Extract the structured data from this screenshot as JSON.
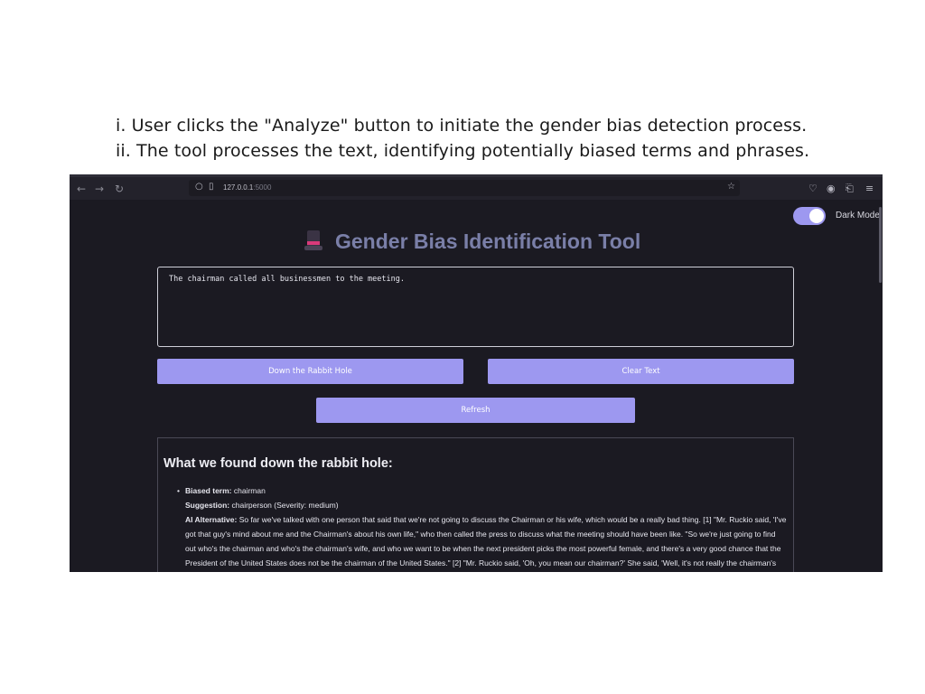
{
  "caption": {
    "line1": "i. User clicks the \"Analyze\" button to initiate the gender bias detection process.",
    "line2": "ii. The tool processes the text, identifying potentially biased terms and phrases."
  },
  "browser": {
    "url_host": "127.0.0.1",
    "url_port": ":5000"
  },
  "app": {
    "dark_mode_label": "Dark Mode",
    "dark_mode_on": true,
    "title": "Gender Bias Identification Tool",
    "input_text": "The chairman called all businessmen to the meeting.",
    "buttons": {
      "rabbit": "Down the Rabbit Hole",
      "clear": "Clear Text",
      "refresh": "Refresh"
    },
    "results": {
      "heading": "What we found down the rabbit hole:",
      "items": [
        {
          "biased_label": "Biased term:",
          "biased_value": "chairman",
          "suggestion_label": "Suggestion:",
          "suggestion_value": "chairperson (Severity: medium)",
          "alternative_label": "AI Alternative:",
          "alternative_value": "So far we've talked with one person that said that we're not going to discuss the Chairman or his wife, which would be a really bad thing. [1] \"Mr. Ruckio said, 'I've got that guy's mind about me and the Chairman's about his own life,\" who then called the press to discuss what the meeting should have been like. \"So we're just going to find out who's the chairman and who's the chairman's wife, and who we want to be when the next president picks the most powerful female, and there's a very good chance that the President of the United States does not be the chairman of the United States.\" [2] \"Mr. Ruckio said, 'Oh, you mean our chairman?' She said, 'Well, it's not really the chairman's"
        }
      ]
    }
  },
  "colors": {
    "app_bg": "#1b1a22",
    "accent": "#9d98f0",
    "title": "#7a7fa8",
    "hat_band": "#d93a7a"
  }
}
